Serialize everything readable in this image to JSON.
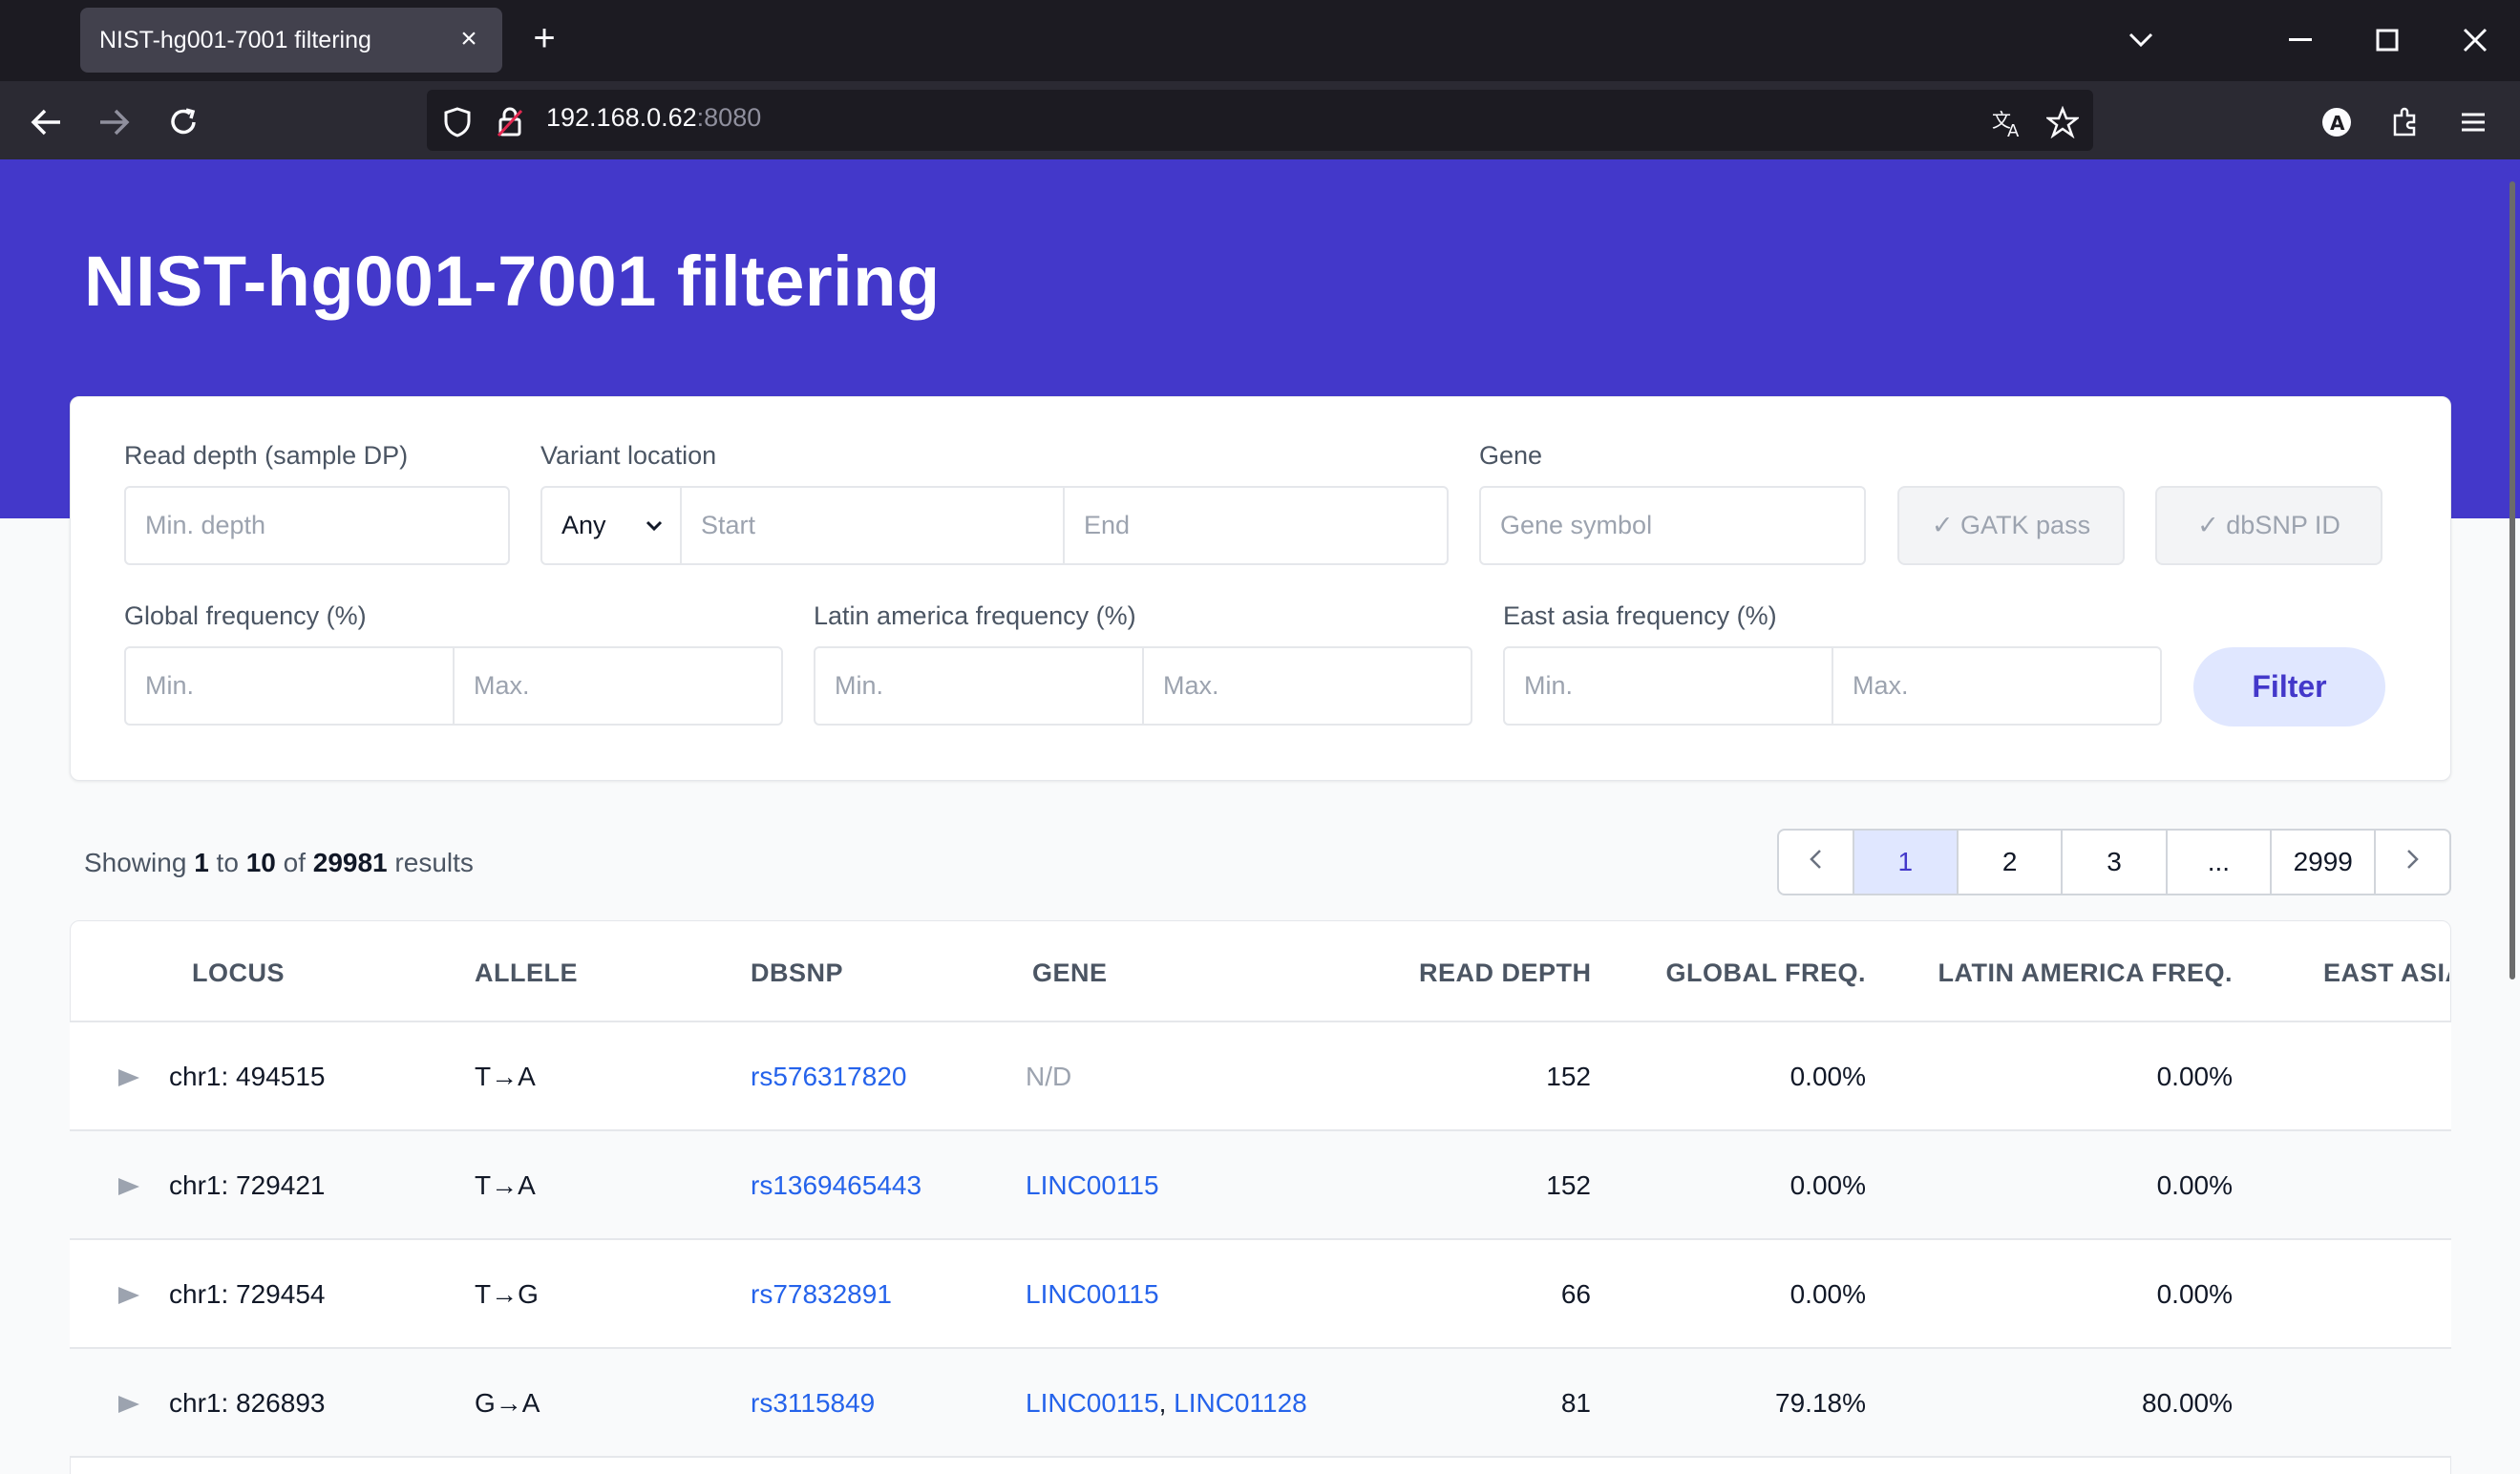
{
  "browser": {
    "tab_title": "NIST-hg001-7001 filtering",
    "url_host": "192.168.0.62",
    "url_port": ":8080"
  },
  "page": {
    "title": "NIST-hg001-7001 filtering"
  },
  "filters": {
    "read_depth_label": "Read depth (sample DP)",
    "read_depth_placeholder": "Min. depth",
    "variant_location_label": "Variant location",
    "location_select_value": "Any",
    "start_placeholder": "Start",
    "end_placeholder": "End",
    "gene_label": "Gene",
    "gene_placeholder": "Gene symbol",
    "gatk_chip": "✓ GATK pass",
    "dbsnp_chip": "✓ dbSNP ID",
    "global_freq_label": "Global frequency (%)",
    "latin_freq_label": "Latin america frequency (%)",
    "east_asia_freq_label": "East asia frequency (%)",
    "min_placeholder": "Min.",
    "max_placeholder": "Max.",
    "filter_button": "Filter"
  },
  "results": {
    "prefix": "Showing",
    "from": "1",
    "to_word": "to",
    "to": "10",
    "of_word": "of",
    "total": "29981",
    "suffix": "results"
  },
  "pagination": {
    "prev": "‹",
    "pages": [
      "1",
      "2",
      "3",
      "...",
      "2999"
    ],
    "next": "›",
    "active": "1"
  },
  "table": {
    "headers": {
      "locus": "LOCUS",
      "allele": "ALLELE",
      "dbsnp": "DBSNP",
      "gene": "GENE",
      "read_depth": "READ DEPTH",
      "global_freq": "GLOBAL FREQ.",
      "latin_freq": "LATIN AMERICA FREQ.",
      "east_asia": "EAST ASIA"
    },
    "rows": [
      {
        "locus": "chr1: 494515",
        "allele": "T→A",
        "dbsnp": "rs576317820",
        "gene": "N/D",
        "gene2": "",
        "read_depth": "152",
        "global_freq": "0.00%",
        "latin_freq": "0.00%"
      },
      {
        "locus": "chr1: 729421",
        "allele": "T→A",
        "dbsnp": "rs1369465443",
        "gene": "LINC00115",
        "gene2": "",
        "read_depth": "152",
        "global_freq": "0.00%",
        "latin_freq": "0.00%"
      },
      {
        "locus": "chr1: 729454",
        "allele": "T→G",
        "dbsnp": "rs77832891",
        "gene": "LINC00115",
        "gene2": "",
        "read_depth": "66",
        "global_freq": "0.00%",
        "latin_freq": "0.00%"
      },
      {
        "locus": "chr1: 826893",
        "allele": "G→A",
        "dbsnp": "rs3115849",
        "gene": "LINC00115",
        "gene2": "LINC01128",
        "read_depth": "81",
        "global_freq": "79.18%",
        "latin_freq": "80.00%"
      }
    ]
  },
  "colors": {
    "brand": "#4338ca",
    "link": "#2563eb",
    "active_page_bg": "#e0e7ff"
  }
}
